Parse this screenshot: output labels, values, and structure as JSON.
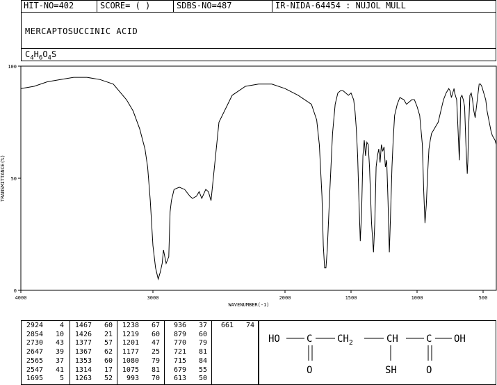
{
  "header": {
    "hit": "HIT-NO=402",
    "score": "SCORE=  (  )",
    "sdbs": "SDBS-NO=487",
    "ir": "IR-NIDA-64454 : NUJOL MULL"
  },
  "compound": {
    "name": "MERCAPTOSUCCINIC ACID",
    "formula_parts": [
      "C",
      "4",
      "H",
      "6",
      "O",
      "4",
      "S"
    ]
  },
  "chart_data": {
    "type": "line",
    "title": "",
    "xlabel": "WAVENUMBER(-1)",
    "ylabel": "TRANSMITTANCE(%)",
    "xlim": [
      4000,
      400
    ],
    "ylim": [
      0,
      100
    ],
    "x_reversed": true,
    "x_ticks": [
      4000,
      3000,
      2000,
      1500,
      1000,
      500
    ],
    "x_tick_labels": [
      "4000",
      "3000",
      "2000",
      "1500",
      "1000",
      "500"
    ],
    "y_ticks": [
      0,
      50,
      100
    ],
    "y_tick_labels": [
      "0",
      "50",
      "100"
    ],
    "series": [
      {
        "x": [
          4000,
          3900,
          3800,
          3700,
          3600,
          3500,
          3400,
          3300,
          3200,
          3150,
          3100,
          3060,
          3040,
          3020,
          3000,
          2980,
          2960,
          2945,
          2930,
          2920,
          2900,
          2880,
          2870,
          2860,
          2840,
          2800,
          2760,
          2720,
          2700,
          2670,
          2650,
          2630,
          2600,
          2580,
          2560,
          2500,
          2400,
          2300,
          2200,
          2100,
          2000,
          1900,
          1800,
          1760,
          1740,
          1720,
          1710,
          1700,
          1690,
          1680,
          1660,
          1640,
          1620,
          1600,
          1580,
          1560,
          1540,
          1520,
          1500,
          1480,
          1470,
          1460,
          1450,
          1440,
          1430,
          1420,
          1410,
          1400,
          1390,
          1380,
          1370,
          1360,
          1345,
          1330,
          1320,
          1310,
          1300,
          1290,
          1280,
          1270,
          1260,
          1250,
          1240,
          1230,
          1220,
          1210,
          1200,
          1190,
          1180,
          1170,
          1150,
          1130,
          1100,
          1080,
          1060,
          1040,
          1020,
          1000,
          980,
          960,
          950,
          940,
          930,
          920,
          910,
          900,
          890,
          880,
          870,
          860,
          840,
          820,
          800,
          780,
          760,
          750,
          740,
          730,
          720,
          715,
          710,
          700,
          690,
          680,
          675,
          670,
          660,
          650,
          640,
          630,
          620,
          615,
          610,
          600,
          590,
          580,
          570,
          560,
          550,
          540,
          530,
          520,
          510,
          500,
          490,
          480,
          470,
          460,
          450,
          440,
          430,
          420,
          410,
          400
        ],
        "y": [
          90,
          91,
          93,
          94,
          95,
          95,
          94,
          92,
          85,
          80,
          72,
          63,
          55,
          40,
          20,
          10,
          5,
          8,
          12,
          18,
          12,
          15,
          35,
          40,
          45,
          46,
          45,
          42,
          41,
          42,
          44,
          41,
          45,
          44,
          40,
          75,
          87,
          91,
          92,
          92,
          90,
          87,
          83,
          76,
          65,
          42,
          20,
          10,
          10,
          18,
          45,
          70,
          83,
          88,
          89,
          89,
          88,
          87,
          88,
          85,
          80,
          72,
          60,
          40,
          22,
          35,
          60,
          67,
          60,
          66,
          65,
          55,
          30,
          17,
          30,
          55,
          60,
          63,
          57,
          65,
          62,
          64,
          55,
          58,
          40,
          17,
          35,
          55,
          68,
          78,
          83,
          86,
          85,
          83,
          84,
          85,
          85,
          82,
          78,
          65,
          45,
          30,
          38,
          52,
          63,
          67,
          70,
          71,
          72,
          73,
          75,
          80,
          85,
          88,
          90,
          89,
          86,
          88,
          90,
          88,
          87,
          85,
          72,
          58,
          70,
          86,
          87,
          85,
          82,
          65,
          52,
          58,
          72,
          87,
          88,
          85,
          80,
          77,
          82,
          87,
          92,
          92,
          91,
          89,
          87,
          85,
          80,
          77,
          74,
          71,
          69,
          68,
          67,
          65
        ]
      }
    ]
  },
  "peaks": {
    "col1": [
      [
        "2924",
        "4"
      ],
      [
        "2854",
        "10"
      ],
      [
        "2730",
        "43"
      ],
      [
        "2647",
        "39"
      ],
      [
        "2565",
        "37"
      ],
      [
        "2547",
        "41"
      ],
      [
        "1695",
        "5"
      ]
    ],
    "col2": [
      [
        "1467",
        "60"
      ],
      [
        "1426",
        "21"
      ],
      [
        "1377",
        "57"
      ],
      [
        "1367",
        "62"
      ],
      [
        "1353",
        "60"
      ],
      [
        "1314",
        "17"
      ],
      [
        "1263",
        "52"
      ]
    ],
    "col3": [
      [
        "1238",
        "67"
      ],
      [
        "1219",
        "60"
      ],
      [
        "1201",
        "47"
      ],
      [
        "1177",
        "25"
      ],
      [
        "1080",
        "79"
      ],
      [
        "1075",
        "81"
      ],
      [
        "993",
        "70"
      ]
    ],
    "col4": [
      [
        "936",
        "37"
      ],
      [
        "879",
        "60"
      ],
      [
        "770",
        "79"
      ],
      [
        "721",
        "81"
      ],
      [
        "715",
        "84"
      ],
      [
        "679",
        "55"
      ],
      [
        "613",
        "50"
      ]
    ],
    "col5": [
      [
        "661",
        "74"
      ]
    ]
  },
  "structure": {
    "ho": "HO",
    "c1": "C",
    "ch2": "CH",
    "ch2_sub": "2",
    "ch": "CH",
    "c2": "C",
    "oh": "OH",
    "o1": "O",
    "sh": "SH",
    "o2": "O"
  }
}
